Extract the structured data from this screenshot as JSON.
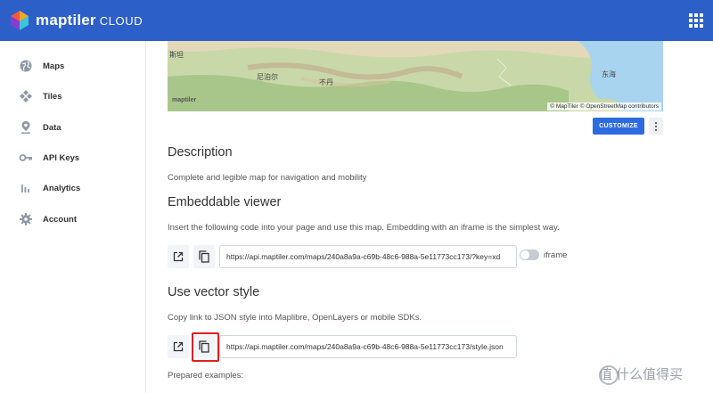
{
  "header": {
    "brand_main": "maptiler",
    "brand_sub": "CLOUD",
    "logo_icon": "maptiler-logo-icon",
    "apps_icon": "apps-grid-icon"
  },
  "sidebar": {
    "items": [
      {
        "label": "Maps",
        "icon": "globe-icon"
      },
      {
        "label": "Tiles",
        "icon": "tiles-icon"
      },
      {
        "label": "Data",
        "icon": "map-pin-icon"
      },
      {
        "label": "API Keys",
        "icon": "key-icon"
      },
      {
        "label": "Analytics",
        "icon": "bar-chart-icon"
      },
      {
        "label": "Account",
        "icon": "gear-icon"
      }
    ]
  },
  "map": {
    "labels": [
      "斯坦",
      "尼泊尔",
      "不丹",
      "东海"
    ],
    "logo_text": "maptiler",
    "attribution": "© MapTiler © OpenStreetMap contributors"
  },
  "toolbar": {
    "customize_label": "CUSTOMIZE"
  },
  "description": {
    "title": "Description",
    "text": "Complete and legible map for navigation and mobility"
  },
  "embeddable": {
    "title": "Embeddable viewer",
    "text": "Insert the following code into your page and use this map. Embedding with an iframe is the simplest way.",
    "url": "https://api.maptiler.com/maps/240a8a9a-c69b-48c6-988a-5e11773cc173/?key=xd",
    "toggle_label": "iframe",
    "toggle_on": false
  },
  "vector_style": {
    "title": "Use vector style",
    "text": "Copy link to JSON style into Maplibre, OpenLayers or mobile SDKs.",
    "url": "https://api.maptiler.com/maps/240a8a9a-c69b-48c6-988a-5e11773cc173/style.json"
  },
  "prepared": {
    "text": "Prepared examples:"
  },
  "watermark": {
    "text": "值 什么值得买"
  },
  "colors": {
    "header": "#2d5fc9",
    "accent": "#2d6ce0",
    "highlight": "#e02020"
  }
}
